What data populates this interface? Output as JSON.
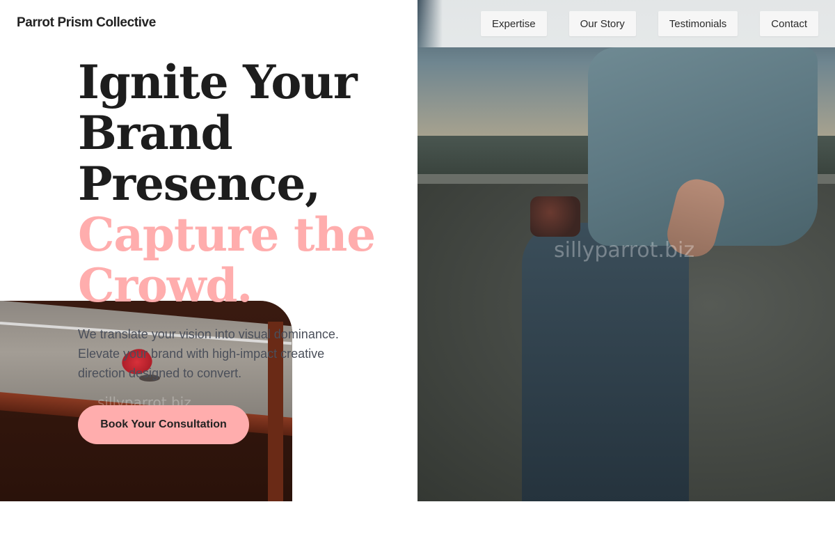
{
  "header": {
    "logo": "Parrot Prism Collective",
    "nav": [
      {
        "label": "Expertise"
      },
      {
        "label": "Our Story"
      },
      {
        "label": "Testimonials"
      },
      {
        "label": "Contact"
      }
    ]
  },
  "hero": {
    "headline_lines": [
      "Ignite Your",
      "Brand",
      "Presence,"
    ],
    "accent_lines": [
      "Capture the",
      "Crowd."
    ],
    "subtext": "We translate your vision into visual dominance. Elevate your brand with high-impact creative direction designed to convert.",
    "cta_label": "Book Your Consultation"
  },
  "watermarks": {
    "right": "sillyparrot.biz",
    "left": "sillyparrot.biz"
  },
  "colors": {
    "accent": "#ffadad",
    "text_dark": "#1d1d1d",
    "text_muted": "#4a4f5a"
  }
}
